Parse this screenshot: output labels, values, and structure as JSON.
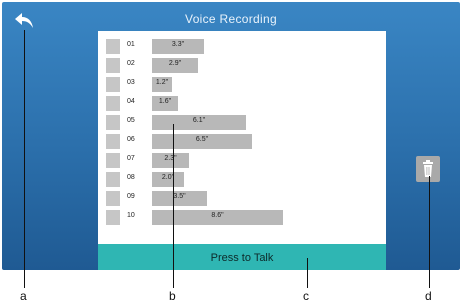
{
  "header": {
    "title": "Voice Recording"
  },
  "recordings": [
    {
      "index": "01",
      "duration": "3.3\"",
      "seconds": 3.3
    },
    {
      "index": "02",
      "duration": "2.9\"",
      "seconds": 2.9
    },
    {
      "index": "03",
      "duration": "1.2\"",
      "seconds": 1.2
    },
    {
      "index": "04",
      "duration": "1.6\"",
      "seconds": 1.6
    },
    {
      "index": "05",
      "duration": "6.1\"",
      "seconds": 6.1
    },
    {
      "index": "06",
      "duration": "6.5\"",
      "seconds": 6.5
    },
    {
      "index": "07",
      "duration": "2.3\"",
      "seconds": 2.3
    },
    {
      "index": "08",
      "duration": "2.0\"",
      "seconds": 2.0
    },
    {
      "index": "09",
      "duration": "3.5\"",
      "seconds": 3.5
    },
    {
      "index": "10",
      "duration": "8.6\"",
      "seconds": 8.6
    }
  ],
  "talk_button": {
    "label": "Press to Talk"
  },
  "icons": {
    "back": "back-arrow-icon",
    "delete": "trash-icon"
  },
  "colors": {
    "screen": "#2b6fab",
    "talk_button": "#2fb6b3",
    "bar": "#b8b8b8"
  },
  "callouts": {
    "a": "a",
    "b": "b",
    "c": "c",
    "d": "d"
  }
}
